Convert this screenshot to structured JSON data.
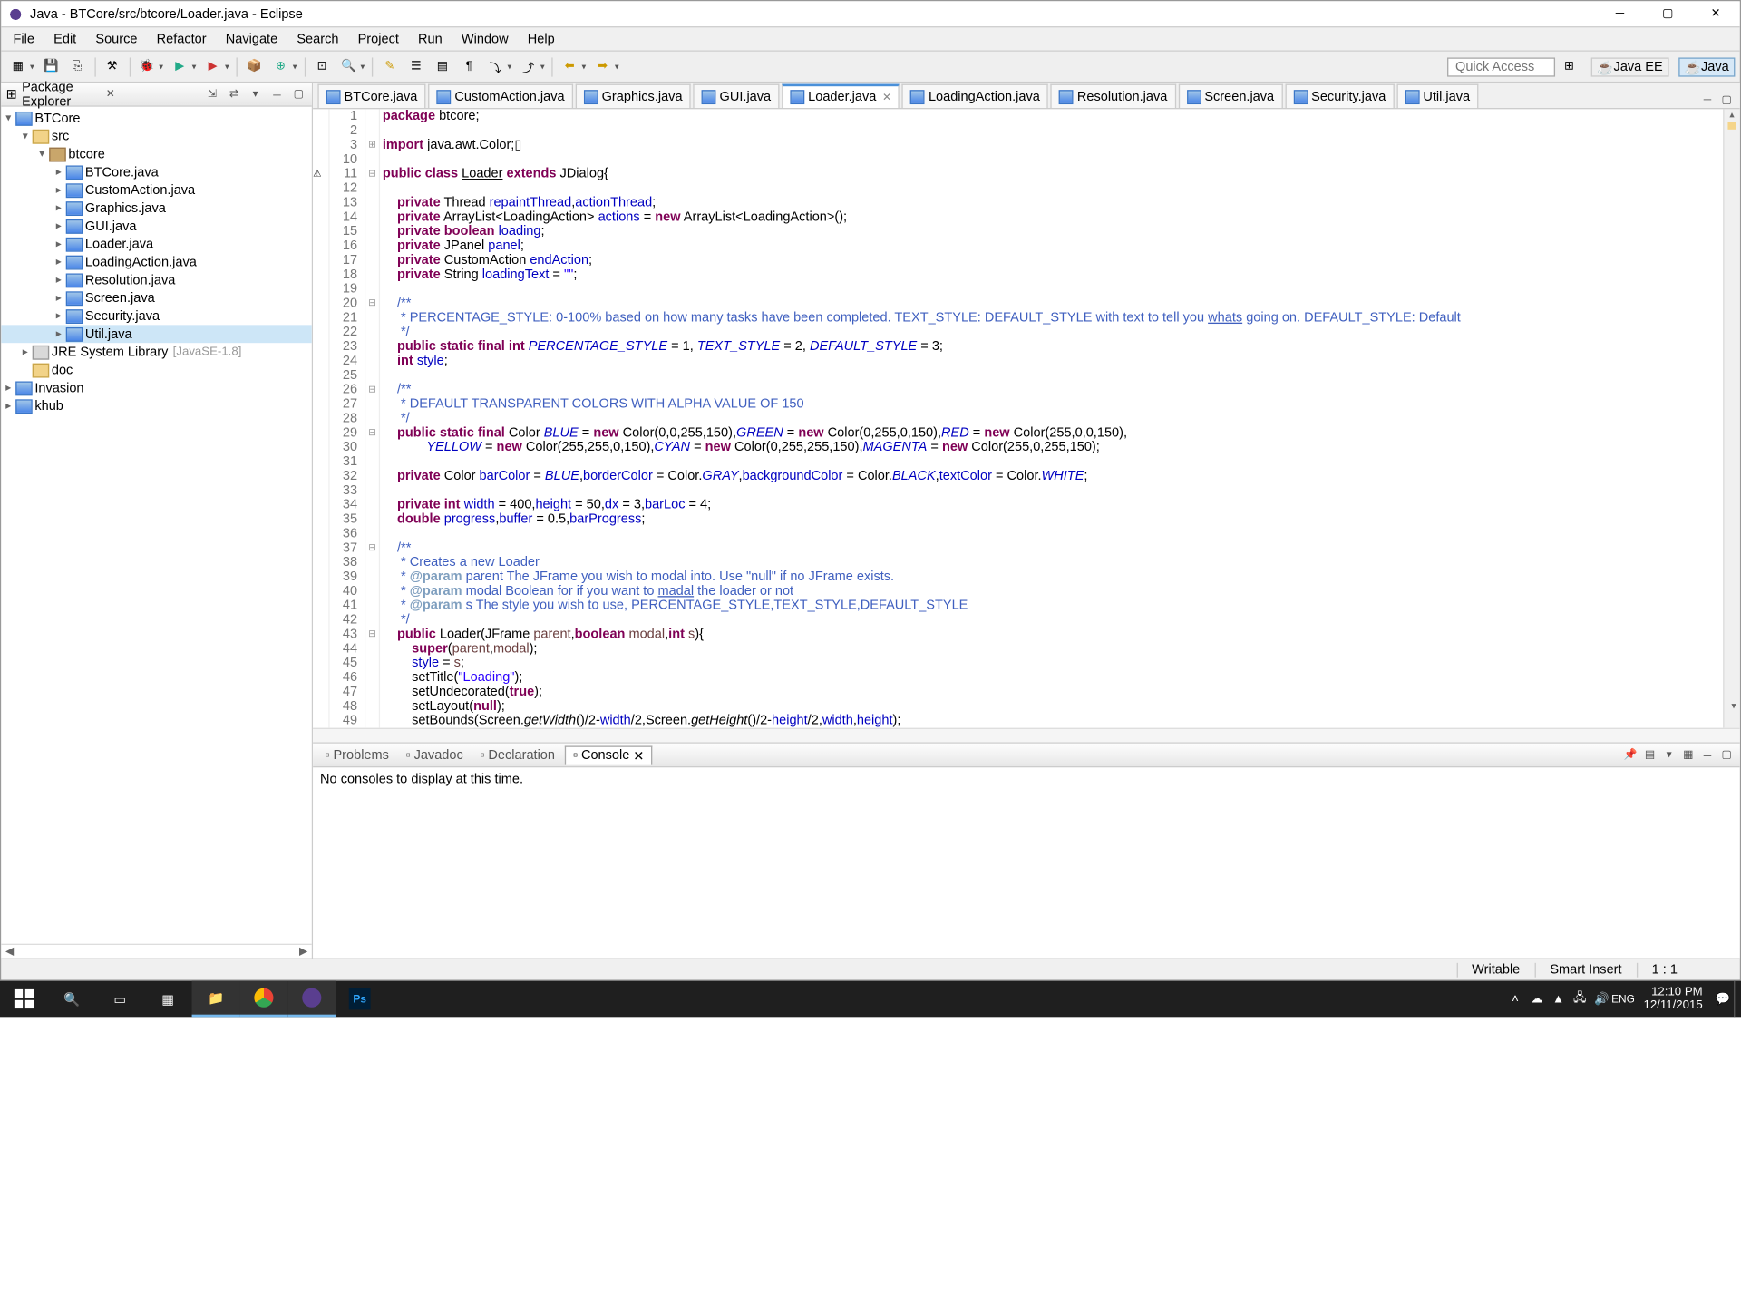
{
  "title": "Java - BTCore/src/btcore/Loader.java - Eclipse",
  "menus": [
    "File",
    "Edit",
    "Source",
    "Refactor",
    "Navigate",
    "Search",
    "Project",
    "Run",
    "Window",
    "Help"
  ],
  "quick_access": "Quick Access",
  "perspectives": [
    {
      "label": "Java EE",
      "active": false
    },
    {
      "label": "Java",
      "active": true
    }
  ],
  "explorer": {
    "title": "Package Explorer",
    "tree": [
      {
        "d": 0,
        "exp": "▾",
        "icon": "ij",
        "label": "BTCore"
      },
      {
        "d": 1,
        "exp": "▾",
        "icon": "ifold",
        "label": "src"
      },
      {
        "d": 2,
        "exp": "▾",
        "icon": "ipkg",
        "label": "btcore"
      },
      {
        "d": 3,
        "exp": "▸",
        "icon": "ij",
        "label": "BTCore.java"
      },
      {
        "d": 3,
        "exp": "▸",
        "icon": "ij",
        "label": "CustomAction.java"
      },
      {
        "d": 3,
        "exp": "▸",
        "icon": "ij",
        "label": "Graphics.java"
      },
      {
        "d": 3,
        "exp": "▸",
        "icon": "ij",
        "label": "GUI.java"
      },
      {
        "d": 3,
        "exp": "▸",
        "icon": "ij",
        "label": "Loader.java"
      },
      {
        "d": 3,
        "exp": "▸",
        "icon": "ij",
        "label": "LoadingAction.java"
      },
      {
        "d": 3,
        "exp": "▸",
        "icon": "ij",
        "label": "Resolution.java"
      },
      {
        "d": 3,
        "exp": "▸",
        "icon": "ij",
        "label": "Screen.java"
      },
      {
        "d": 3,
        "exp": "▸",
        "icon": "ij",
        "label": "Security.java"
      },
      {
        "d": 3,
        "exp": "▸",
        "icon": "ij",
        "label": "Util.java",
        "sel": true
      },
      {
        "d": 1,
        "exp": "▸",
        "icon": "ijar",
        "label": "JRE System Library",
        "deco": "[JavaSE-1.8]"
      },
      {
        "d": 1,
        "exp": "",
        "icon": "ifold",
        "label": "doc"
      },
      {
        "d": 0,
        "exp": "▸",
        "icon": "ij",
        "label": "Invasion"
      },
      {
        "d": 0,
        "exp": "▸",
        "icon": "ij",
        "label": "khub"
      }
    ]
  },
  "editor_tabs": [
    {
      "label": "BTCore.java"
    },
    {
      "label": "CustomAction.java"
    },
    {
      "label": "Graphics.java"
    },
    {
      "label": "GUI.java"
    },
    {
      "label": "Loader.java",
      "active": true
    },
    {
      "label": "LoadingAction.java"
    },
    {
      "label": "Resolution.java"
    },
    {
      "label": "Screen.java"
    },
    {
      "label": "Security.java"
    },
    {
      "label": "Util.java"
    }
  ],
  "code_lines": [
    {
      "n": 1,
      "mk": "",
      "fd": "",
      "html": "<span class='kw'>package</span> btcore;"
    },
    {
      "n": 2,
      "mk": "",
      "fd": "",
      "html": ""
    },
    {
      "n": 3,
      "mk": "",
      "fd": "⊞",
      "html": "<span class='kw'>import</span> java.awt.Color;▯"
    },
    {
      "n": 10,
      "mk": "",
      "fd": "",
      "html": ""
    },
    {
      "n": 11,
      "mk": "⚠",
      "fd": "⊟",
      "html": "<span class='kw'>public</span> <span class='kw'>class</span> <u>Loader</u> <span class='kw'>extends</span> JDialog{"
    },
    {
      "n": 12,
      "mk": "",
      "fd": "",
      "html": ""
    },
    {
      "n": 13,
      "mk": "",
      "fd": "",
      "html": "    <span class='kw'>private</span> Thread <span class='fld'>repaintThread</span>,<span class='fld'>actionThread</span>;"
    },
    {
      "n": 14,
      "mk": "",
      "fd": "",
      "html": "    <span class='kw'>private</span> ArrayList&lt;LoadingAction&gt; <span class='fld'>actions</span> = <span class='kw'>new</span> ArrayList&lt;LoadingAction&gt;();"
    },
    {
      "n": 15,
      "mk": "",
      "fd": "",
      "html": "    <span class='kw'>private</span> <span class='kw'>boolean</span> <span class='fld'>loading</span>;"
    },
    {
      "n": 16,
      "mk": "",
      "fd": "",
      "html": "    <span class='kw'>private</span> JPanel <span class='fld'>panel</span>;"
    },
    {
      "n": 17,
      "mk": "",
      "fd": "",
      "html": "    <span class='kw'>private</span> CustomAction <span class='fld'>endAction</span>;"
    },
    {
      "n": 18,
      "mk": "",
      "fd": "",
      "html": "    <span class='kw'>private</span> String <span class='fld'>loadingText</span> = <span class='str'>\"\"</span>;"
    },
    {
      "n": 19,
      "mk": "",
      "fd": "",
      "html": ""
    },
    {
      "n": 20,
      "mk": "",
      "fd": "⊟",
      "html": "    <span class='jd'>/**</span>"
    },
    {
      "n": 21,
      "mk": "",
      "fd": "",
      "html": "<span class='jd'>     * PERCENTAGE_STYLE: 0-100% based on how many tasks have been completed. TEXT_STYLE: DEFAULT_STYLE with text to tell you <u>whats</u> going on. DEFAULT_STYLE: Default</span>"
    },
    {
      "n": 22,
      "mk": "",
      "fd": "",
      "html": "<span class='jd'>     */</span>"
    },
    {
      "n": 23,
      "mk": "",
      "fd": "",
      "html": "    <span class='kw'>public</span> <span class='kw'>static</span> <span class='kw'>final</span> <span class='kw'>int</span> <span class='fldi'>PERCENTAGE_STYLE</span> = 1, <span class='fldi'>TEXT_STYLE</span> = 2, <span class='fldi'>DEFAULT_STYLE</span> = 3;"
    },
    {
      "n": 24,
      "mk": "",
      "fd": "",
      "html": "    <span class='kw'>int</span> <span class='fld'>style</span>;"
    },
    {
      "n": 25,
      "mk": "",
      "fd": "",
      "html": ""
    },
    {
      "n": 26,
      "mk": "",
      "fd": "⊟",
      "html": "    <span class='jd'>/**</span>"
    },
    {
      "n": 27,
      "mk": "",
      "fd": "",
      "html": "<span class='jd'>     * DEFAULT TRANSPARENT COLORS WITH ALPHA VALUE OF 150</span>"
    },
    {
      "n": 28,
      "mk": "",
      "fd": "",
      "html": "<span class='jd'>     */</span>"
    },
    {
      "n": 29,
      "mk": "",
      "fd": "⊟",
      "html": "    <span class='kw'>public</span> <span class='kw'>static</span> <span class='kw'>final</span> Color <span class='fldi'>BLUE</span> = <span class='kw'>new</span> Color(0,0,255,150),<span class='fldi'>GREEN</span> = <span class='kw'>new</span> Color(0,255,0,150),<span class='fldi'>RED</span> = <span class='kw'>new</span> Color(255,0,0,150),"
    },
    {
      "n": 30,
      "mk": "",
      "fd": "",
      "html": "            <span class='fldi'>YELLOW</span> = <span class='kw'>new</span> Color(255,255,0,150),<span class='fldi'>CYAN</span> = <span class='kw'>new</span> Color(0,255,255,150),<span class='fldi'>MAGENTA</span> = <span class='kw'>new</span> Color(255,0,255,150);"
    },
    {
      "n": 31,
      "mk": "",
      "fd": "",
      "html": ""
    },
    {
      "n": 32,
      "mk": "",
      "fd": "",
      "html": "    <span class='kw'>private</span> Color <span class='fld'>barColor</span> = <span class='fldi'>BLUE</span>,<span class='fld'>borderColor</span> = Color.<span class='fldi'>GRAY</span>,<span class='fld'>backgroundColor</span> = Color.<span class='fldi'>BLACK</span>,<span class='fld'>textColor</span> = Color.<span class='fldi'>WHITE</span>;"
    },
    {
      "n": 33,
      "mk": "",
      "fd": "",
      "html": ""
    },
    {
      "n": 34,
      "mk": "",
      "fd": "",
      "html": "    <span class='kw'>private</span> <span class='kw'>int</span> <span class='fld'>width</span> = 400,<span class='fld'>height</span> = 50,<span class='fld'>dx</span> = 3,<span class='fld'>barLoc</span> = 4;"
    },
    {
      "n": 35,
      "mk": "",
      "fd": "",
      "html": "    <span class='kw'>double</span> <span class='fld'>progress</span>,<span class='fld'>buffer</span> = 0.5,<span class='fld'>barProgress</span>;"
    },
    {
      "n": 36,
      "mk": "",
      "fd": "",
      "html": ""
    },
    {
      "n": 37,
      "mk": "",
      "fd": "⊟",
      "html": "    <span class='jd'>/**</span>"
    },
    {
      "n": 38,
      "mk": "",
      "fd": "",
      "html": "<span class='jd'>     * Creates a new Loader</span>"
    },
    {
      "n": 39,
      "mk": "",
      "fd": "",
      "html": "<span class='jd'>     * <span class='jdt'>@param</span> parent The JFrame you wish to modal into. Use \"null\" if no JFrame exists.</span>"
    },
    {
      "n": 40,
      "mk": "",
      "fd": "",
      "html": "<span class='jd'>     * <span class='jdt'>@param</span> modal Boolean for if you want to <u>madal</u> the loader or not</span>"
    },
    {
      "n": 41,
      "mk": "",
      "fd": "",
      "html": "<span class='jd'>     * <span class='jdt'>@param</span> s The style you wish to use, PERCENTAGE_STYLE,TEXT_STYLE,DEFAULT_STYLE</span>"
    },
    {
      "n": 42,
      "mk": "",
      "fd": "",
      "html": "<span class='jd'>     */</span>"
    },
    {
      "n": 43,
      "mk": "",
      "fd": "⊟",
      "html": "    <span class='kw'>public</span> Loader(JFrame <span class='arg'>parent</span>,<span class='kw'>boolean</span> <span class='arg'>modal</span>,<span class='kw'>int</span> <span class='arg'>s</span>){"
    },
    {
      "n": 44,
      "mk": "",
      "fd": "",
      "html": "        <span class='kw'>super</span>(<span class='arg'>parent</span>,<span class='arg'>modal</span>);"
    },
    {
      "n": 45,
      "mk": "",
      "fd": "",
      "html": "        <span class='fld'>style</span> = <span class='arg'>s</span>;"
    },
    {
      "n": 46,
      "mk": "",
      "fd": "",
      "html": "        setTitle(<span class='str'>\"Loading\"</span>);"
    },
    {
      "n": 47,
      "mk": "",
      "fd": "",
      "html": "        setUndecorated(<span class='kw'>true</span>);"
    },
    {
      "n": 48,
      "mk": "",
      "fd": "",
      "html": "        setLayout(<span class='kw'>null</span>);"
    },
    {
      "n": 49,
      "mk": "",
      "fd": "",
      "html": "        setBounds(Screen.<span style='font-style:italic'>getWidth</span>()/2-<span class='fld'>width</span>/2,Screen.<span style='font-style:italic'>getHeight</span>()/2-<span class='fld'>height</span>/2,<span class='fld'>width</span>,<span class='fld'>height</span>);"
    }
  ],
  "console": {
    "tabs": [
      "Problems",
      "Javadoc",
      "Declaration",
      "Console"
    ],
    "active_tab": "Console",
    "message": "No consoles to display at this time."
  },
  "status": {
    "writable": "Writable",
    "insert": "Smart Insert",
    "pos": "1 : 1"
  },
  "tray": {
    "time": "12:10 PM",
    "date": "12/11/2015"
  }
}
